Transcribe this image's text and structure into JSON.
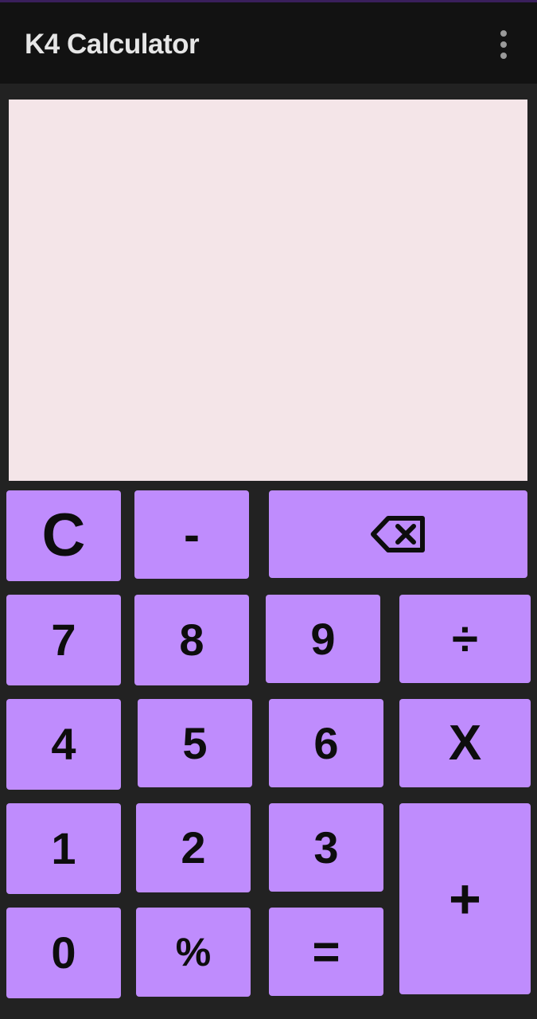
{
  "app": {
    "title": "K4 Calculator",
    "menu_icon": "more-vert-icon"
  },
  "display": {
    "value": ""
  },
  "keys": {
    "clear": "C",
    "minus": "-",
    "backspace_icon": "backspace-icon",
    "seven": "7",
    "eight": "8",
    "nine": "9",
    "divide": "÷",
    "four": "4",
    "five": "5",
    "six": "6",
    "multiply": "X",
    "one": "1",
    "two": "2",
    "three": "3",
    "plus": "+",
    "zero": "0",
    "percent": "%",
    "equals": "="
  },
  "colors": {
    "background": "#222222",
    "app_bar": "#121212",
    "display": "#f4e5e8",
    "key": "#bf8cfd",
    "key_text": "#0d0d0d"
  }
}
